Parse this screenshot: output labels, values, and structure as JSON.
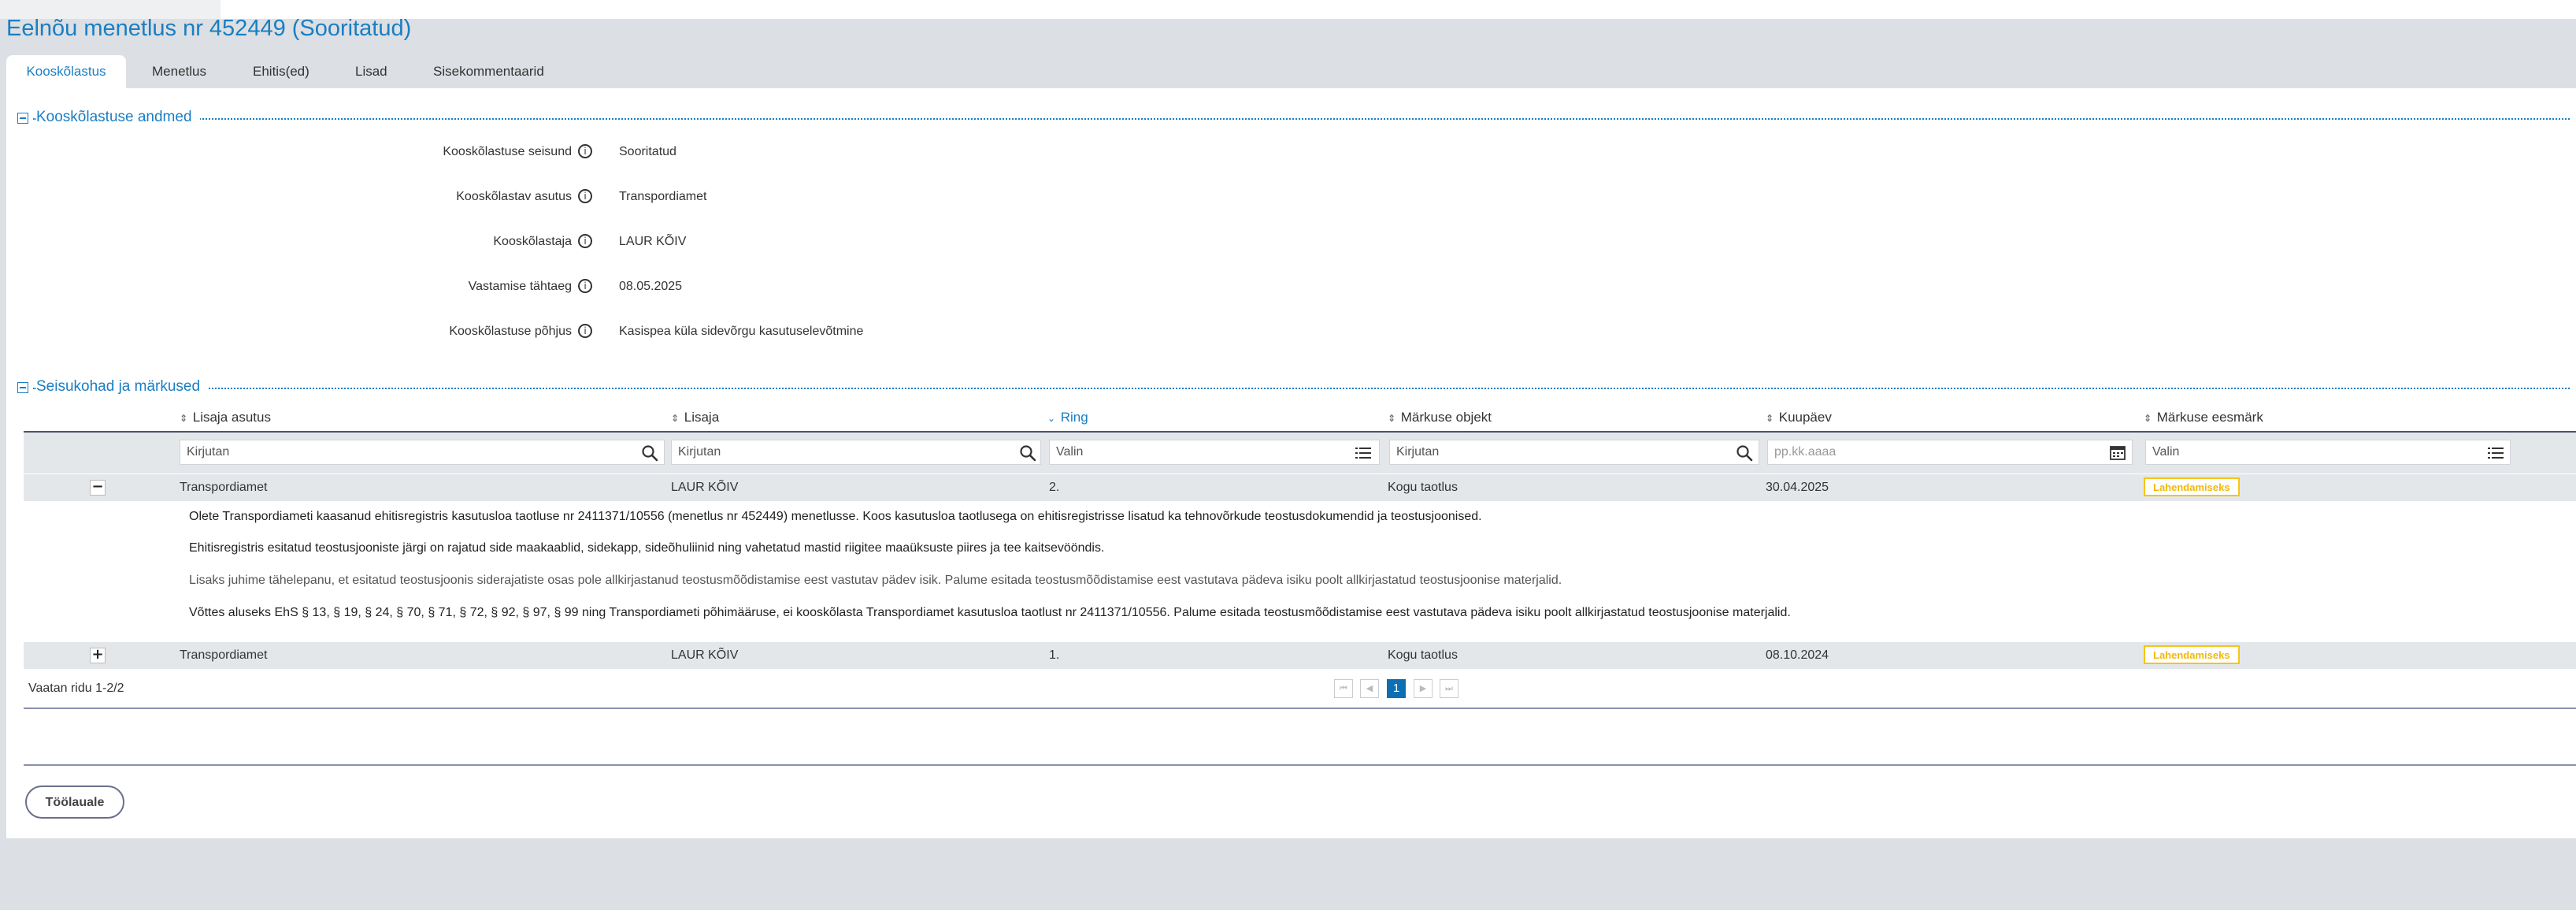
{
  "page": {
    "title": "Eelnõu menetlus nr 452449 (Sooritatud)"
  },
  "tabs": [
    {
      "label": "Kooskõlastus",
      "active": true
    },
    {
      "label": "Menetlus"
    },
    {
      "label": "Ehitis(ed)"
    },
    {
      "label": "Lisad"
    },
    {
      "label": "Sisekommentaarid"
    }
  ],
  "approval_section": {
    "title": "Kooskõlastuse andmed",
    "fields": [
      {
        "label": "Kooskõlastuse seisund",
        "value": "Sooritatud"
      },
      {
        "label": "Kooskõlastav asutus",
        "value": "Transpordiamet"
      },
      {
        "label": "Kooskõlastaja",
        "value": "LAUR KÕIV"
      },
      {
        "label": "Vastamise tähtaeg",
        "value": "08.05.2025"
      },
      {
        "label": "Kooskõlastuse põhjus",
        "value": "Kasispea küla sidevõrgu kasutuselevõtmine"
      }
    ],
    "info_glyph": "i"
  },
  "remarks_section": {
    "title": "Seisukohad ja märkused",
    "columns": [
      {
        "label": "Lisaja asutus",
        "sort": "none"
      },
      {
        "label": "Lisaja",
        "sort": "none"
      },
      {
        "label": "Ring",
        "sort": "desc"
      },
      {
        "label": "Märkuse objekt",
        "sort": "none"
      },
      {
        "label": "Kuupäev",
        "sort": "none"
      },
      {
        "label": "Märkuse eesmärk",
        "sort": "none"
      }
    ],
    "filters": [
      {
        "placeholder": "Kirjutan",
        "icon": "search-icon"
      },
      {
        "placeholder": "Kirjutan",
        "icon": "search-icon"
      },
      {
        "placeholder": "Valin",
        "icon": "list-icon"
      },
      {
        "placeholder": "Kirjutan",
        "icon": "search-icon"
      },
      {
        "placeholder": "pp.kk.aaaa",
        "icon": "calendar-icon"
      },
      {
        "placeholder": "Valin",
        "icon": "list-icon"
      }
    ],
    "rows": [
      {
        "toggle": "−",
        "expanded": true,
        "institution": "Transpordiamet",
        "author": "LAUR KÕIV",
        "round": "2.",
        "object": "Kogu taotlus",
        "date": "30.04.2025",
        "purpose": "Lahendamiseks",
        "details": [
          "Olete Transpordiameti kaasanud ehitisregistris kasutusloa taotluse nr 2411371/10556 (menetlus nr 452449) menetlusse. Koos kasutusloa taotlusega on ehitisregistrisse lisatud ka tehnovõrkude teostusdokumendid ja teostusjoonised.",
          "Ehitisregistris esitatud teostusjooniste järgi on rajatud side maakaablid, sidekapp, sideõhuliinid ning vahetatud mastid riigitee maaüksuste piires ja tee kaitsevööndis.",
          "Lisaks juhime tähelepanu, et esitatud teostusjoonis siderajatiste osas pole allkirjastanud teostusmõõdistamise eest vastutav pädev isik. Palume esitada teostusmõõdistamise eest vastutava pädeva isiku poolt allkirjastatud teostusjoonise materjalid.",
          "Võttes aluseks EhS § 13, § 19, § 24, § 70, § 71, § 72, § 92, § 97, § 99 ning Transpordiameti põhimääruse, ei kooskõlasta Transpordiamet kasutusloa taotlust nr 2411371/10556. Palume esitada teostusmõõdistamise eest vastutava pädeva isiku poolt allkirjastatud teostusjoonise materjalid."
        ]
      },
      {
        "toggle": "+",
        "expanded": false,
        "institution": "Transpordiamet",
        "author": "LAUR KÕIV",
        "round": "1.",
        "object": "Kogu taotlus",
        "date": "08.10.2024",
        "purpose": "Lahendamiseks"
      }
    ],
    "row_count": "Vaatan ridu 1-2/2",
    "pagination": {
      "first": "⏮",
      "prev": "◀",
      "current": "1",
      "next": "▶",
      "last": "⏭"
    }
  },
  "footer": {
    "back_button": "Töölauale"
  },
  "colors": {
    "accent": "#1a7ec2",
    "badge": "#f5c518",
    "pager_active": "#0f6fb3"
  }
}
